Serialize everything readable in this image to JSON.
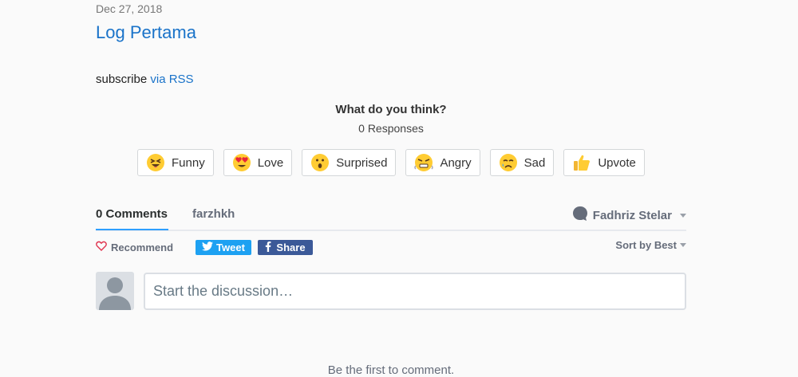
{
  "post": {
    "date": "Dec 27, 2018",
    "title": "Log Pertama",
    "subscribe_prefix": "subscribe ",
    "subscribe_link": "via RSS"
  },
  "reactions": {
    "question": "What do you think?",
    "responses": "0 Responses",
    "items": [
      {
        "label": "Funny",
        "icon": "funny-face-icon"
      },
      {
        "label": "Love",
        "icon": "heart-eyes-icon"
      },
      {
        "label": "Surprised",
        "icon": "surprised-face-icon"
      },
      {
        "label": "Angry",
        "icon": "angry-face-icon"
      },
      {
        "label": "Sad",
        "icon": "sad-face-icon"
      },
      {
        "label": "Upvote",
        "icon": "thumbs-up-icon"
      }
    ]
  },
  "comments": {
    "tab_comments": "0 Comments",
    "tab_community": "farzhkh",
    "user_name": "Fadhriz Stelar",
    "recommend_label": "Recommend",
    "tweet_label": "Tweet",
    "share_label": "Share",
    "sort_label": "Sort by Best",
    "composer_placeholder": "Start the discussion…",
    "empty_note": "Be the first to comment."
  },
  "colors": {
    "link": "#1a73c9",
    "tab_active": "#2e9fff",
    "twitter": "#1da1f2",
    "facebook": "#3b5998",
    "background": "#fafafa"
  }
}
